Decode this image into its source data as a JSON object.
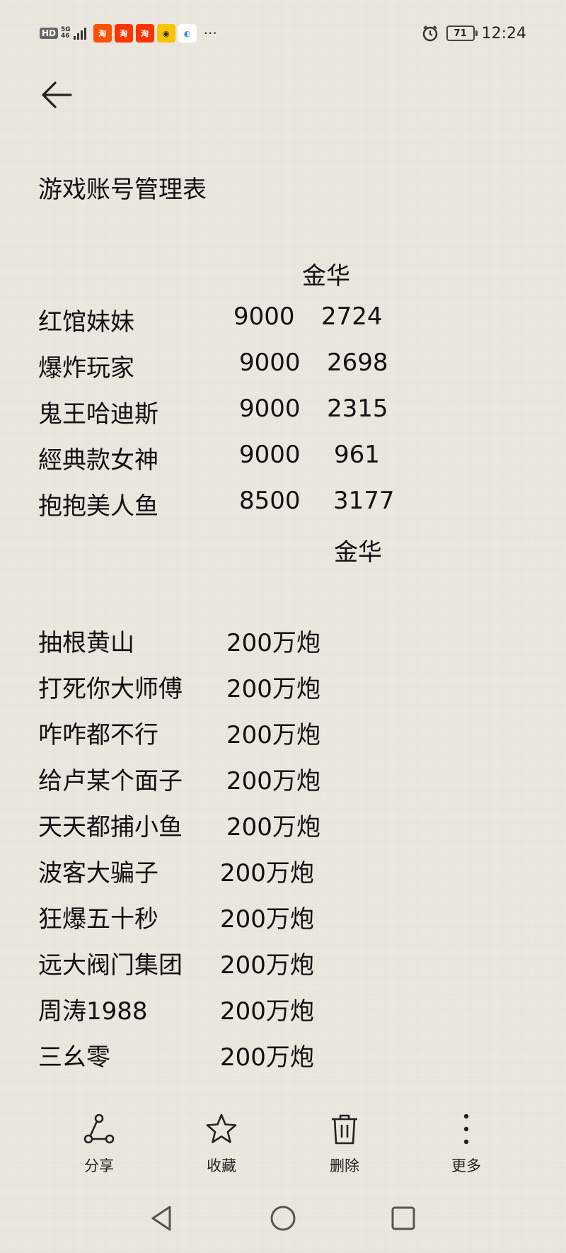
{
  "status_bar": {
    "hd_label": "HD",
    "network_label": "5G",
    "network_sub": "46",
    "app_icons": [
      {
        "name": "taobao-icon",
        "glyph": "淘",
        "color": "#ff5000"
      },
      {
        "name": "taobao-icon-2",
        "glyph": "淘",
        "color": "#ff3300"
      },
      {
        "name": "taobao-icon-3",
        "glyph": "淘",
        "color": "#ff3300"
      },
      {
        "name": "avatar-app-icon",
        "glyph": "◉",
        "color": "#f6c500"
      },
      {
        "name": "browser-icon",
        "glyph": "◐",
        "color": "#2a8cf0"
      }
    ],
    "more_indicator": "···",
    "battery": "71",
    "time": "12:24"
  },
  "note": {
    "title": "游戏账号管理表",
    "header1": "金华",
    "group1": [
      {
        "name": "红馆妹妹",
        "v1": "9000",
        "v2": "2724"
      },
      {
        "name": "爆炸玩家",
        "v1": "9000",
        "v2": "2698"
      },
      {
        "name": "鬼王哈迪斯",
        "v1": "9000",
        "v2": "2315"
      },
      {
        "name": "經典款女神",
        "v1": "9000",
        "v2": "961"
      },
      {
        "name": "抱抱美人鱼",
        "v1": "8500",
        "v2": "3177"
      }
    ],
    "header2": "金华",
    "group2": [
      {
        "name": "抽根黄山",
        "value": "200万炮"
      },
      {
        "name": "打死你大师傅",
        "value": "200万炮"
      },
      {
        "name": "咋咋都不行",
        "value": "200万炮"
      },
      {
        "name": "给卢某个面子",
        "value": "200万炮"
      },
      {
        "name": "天天都捕小鱼",
        "value": "200万炮"
      },
      {
        "name": "波客大骗子",
        "value": "200万炮"
      },
      {
        "name": "狂爆五十秒",
        "value": "200万炮"
      },
      {
        "name": "远大阀门集团",
        "value": "200万炮"
      },
      {
        "name": "周涛1988",
        "value": "200万炮"
      },
      {
        "name": "三幺零",
        "value": "200万炮"
      }
    ]
  },
  "toolbar": {
    "share": "分享",
    "favorite": "收藏",
    "delete": "删除",
    "more": "更多"
  },
  "colors": {
    "background": "#ede8e0",
    "text": "#111111"
  }
}
